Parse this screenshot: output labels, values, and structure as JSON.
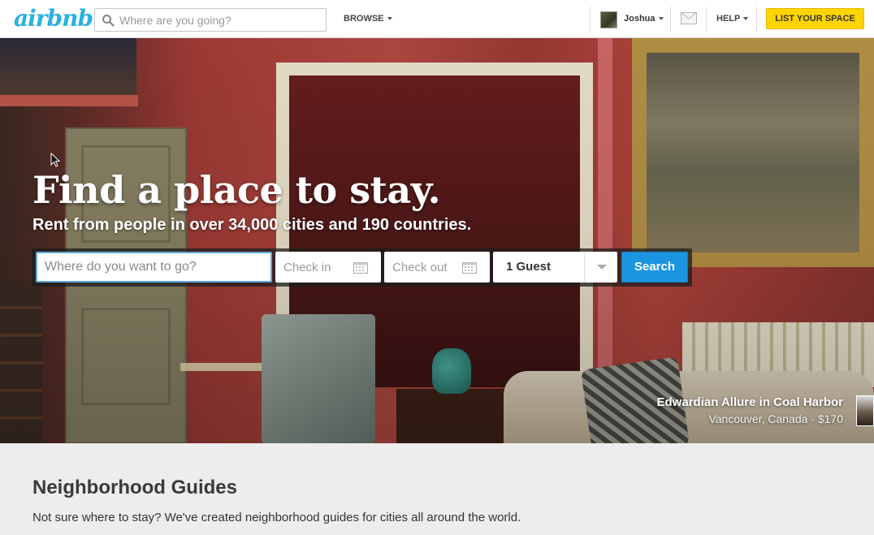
{
  "header": {
    "logo": "airbnb",
    "search_placeholder": "Where are you going?",
    "browse_label": "BROWSE",
    "user_name": "Joshua",
    "help_label": "HELP",
    "list_space_label": "LIST YOUR SPACE"
  },
  "hero": {
    "title": "Find a place to stay.",
    "subtitle": "Rent from people in over 34,000 cities and 190 countries.",
    "search": {
      "where_placeholder": "Where do you want to go?",
      "checkin_placeholder": "Check in",
      "checkout_placeholder": "Check out",
      "guests_value": "1 Guest",
      "search_label": "Search"
    },
    "caption": {
      "title": "Edwardian Allure in Coal Harbor",
      "location": "Vancouver, Canada · $170"
    }
  },
  "guides": {
    "title": "Neighborhood Guides",
    "description": "Not sure where to stay? We've created neighborhood guides for cities all around the world."
  },
  "colors": {
    "brand": "#2ab1de",
    "search_button": "#1b95e0",
    "list_button": "#ffd500"
  },
  "icons": [
    "search-icon",
    "mail-icon",
    "calendar-icon",
    "chevron-down-icon",
    "cursor-icon"
  ]
}
